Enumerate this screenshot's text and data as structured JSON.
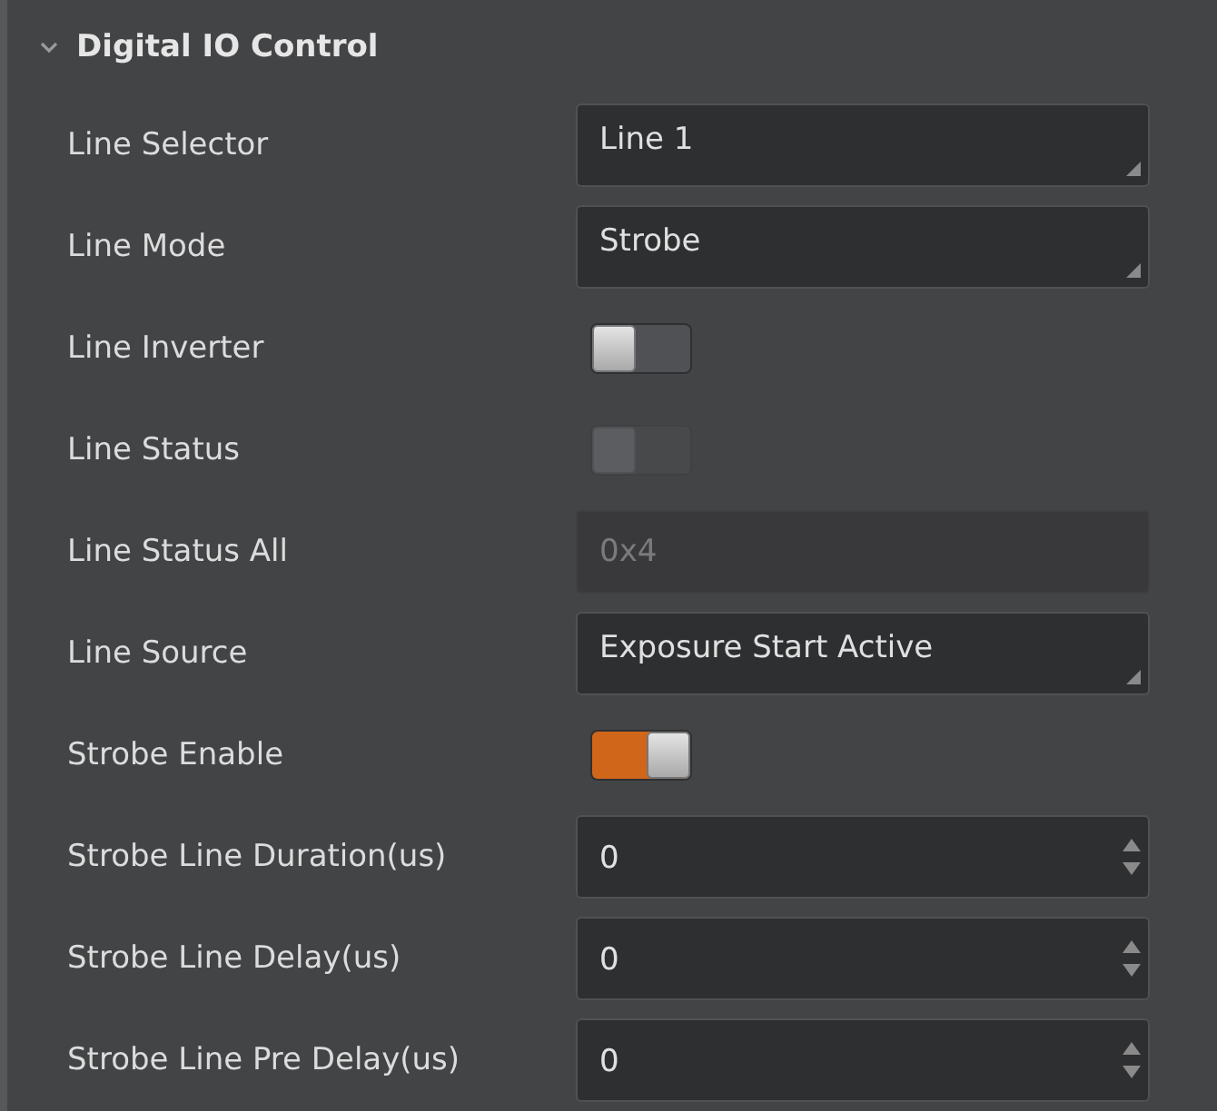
{
  "section": {
    "title": "Digital IO Control",
    "expanded": true
  },
  "rows": [
    {
      "label": "Line Selector",
      "kind": "dropdown",
      "value": "Line 1"
    },
    {
      "label": "Line Mode",
      "kind": "dropdown",
      "value": "Strobe"
    },
    {
      "label": "Line Inverter",
      "kind": "toggle",
      "on": false,
      "disabled": false
    },
    {
      "label": "Line Status",
      "kind": "toggle",
      "on": false,
      "disabled": true
    },
    {
      "label": "Line Status All",
      "kind": "readonly",
      "value": "0x4"
    },
    {
      "label": "Line Source",
      "kind": "dropdown",
      "value": "Exposure Start Active"
    },
    {
      "label": "Strobe Enable",
      "kind": "toggle",
      "on": true,
      "disabled": false
    },
    {
      "label": "Strobe Line Duration(us)",
      "kind": "spin",
      "value": "0"
    },
    {
      "label": "Strobe Line Delay(us)",
      "kind": "spin",
      "value": "0"
    },
    {
      "label": "Strobe Line Pre Delay(us)",
      "kind": "spin",
      "value": "0"
    }
  ]
}
